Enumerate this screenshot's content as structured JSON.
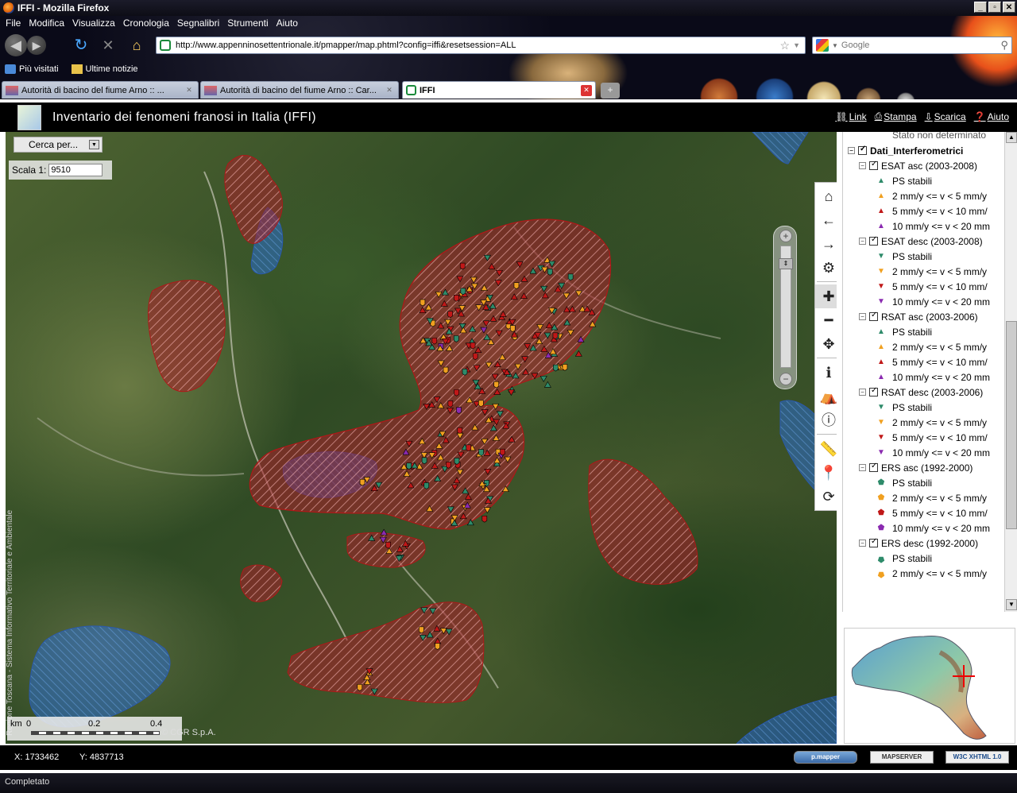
{
  "window": {
    "title": "IFFI - Mozilla Firefox",
    "controls": [
      "_",
      "▫",
      "✕"
    ]
  },
  "menu": [
    "File",
    "Modifica",
    "Visualizza",
    "Cronologia",
    "Segnalibri",
    "Strumenti",
    "Aiuto"
  ],
  "nav": {
    "url": "http://www.appenninosettentrionale.it/pmapper/map.phtml?config=iffi&resetsession=ALL",
    "search_placeholder": "Google"
  },
  "bookmarks": [
    "Più visitati",
    "Ultime notizie"
  ],
  "tabs": [
    {
      "label": "Autorità di bacino del fiume Arno :: ..."
    },
    {
      "label": "Autorità di bacino del fiume Arno :: Car..."
    },
    {
      "label": "IFFI"
    }
  ],
  "app": {
    "title": "Inventario dei fenomeni franosi in Italia (IFFI)",
    "links": [
      "Link",
      "Stampa",
      "Scarica",
      "Aiuto"
    ]
  },
  "map": {
    "search_select": "Cerca per...",
    "scale_label": "Scala 1:",
    "scale_value": "9510",
    "scalebar": {
      "unit": "km",
      "ticks": [
        "0",
        "0.2",
        "0.4"
      ]
    },
    "copyright": "© CGR S.p.A.",
    "vertical_credit": "Regione Toscana - Sistema Informativo Territoriale e Ambientale"
  },
  "legend": {
    "top_cut": "Stato non determinato",
    "group": "Dati_Interferometrici",
    "sublayers": [
      {
        "name": "ESAT asc (2003-2008)",
        "items": [
          "PS stabili",
          "2 mm/y <= v < 5 mm/y",
          "5 mm/y <= v < 10 mm/",
          "10 mm/y <= v < 20 mm"
        ],
        "shape": "tri-up"
      },
      {
        "name": "ESAT desc (2003-2008)",
        "items": [
          "PS stabili",
          "2 mm/y <= v < 5 mm/y",
          "5 mm/y <= v < 10 mm/",
          "10 mm/y <= v < 20 mm"
        ],
        "shape": "tri-down"
      },
      {
        "name": "RSAT asc (2003-2006)",
        "items": [
          "PS stabili",
          "2 mm/y <= v < 5 mm/y",
          "5 mm/y <= v < 10 mm/",
          "10 mm/y <= v < 20 mm"
        ],
        "shape": "tri-up"
      },
      {
        "name": "RSAT desc (2003-2006)",
        "items": [
          "PS stabili",
          "2 mm/y <= v < 5 mm/y",
          "5 mm/y <= v < 10 mm/",
          "10 mm/y <= v < 20 mm"
        ],
        "shape": "tri-down"
      },
      {
        "name": "ERS asc (1992-2000)",
        "items": [
          "PS stabili",
          "2 mm/y <= v < 5 mm/y",
          "5 mm/y <= v < 10 mm/",
          "10 mm/y <= v < 20 mm"
        ],
        "shape": "pent-up"
      },
      {
        "name": "ERS desc (1992-2000)",
        "items": [
          "PS stabili",
          "2 mm/y <= v < 5 mm/y"
        ],
        "shape": "pent-down"
      }
    ],
    "class_colors": [
      "#2e8b6a",
      "#f0a020",
      "#c01818",
      "#8a2ab0"
    ]
  },
  "status": {
    "x": "X: 1733462",
    "y": "Y: 4837713",
    "badges": [
      "p.mapper",
      "MAPSERVER",
      "W3C XHTML 1.0"
    ]
  },
  "browser_status": "Completato"
}
